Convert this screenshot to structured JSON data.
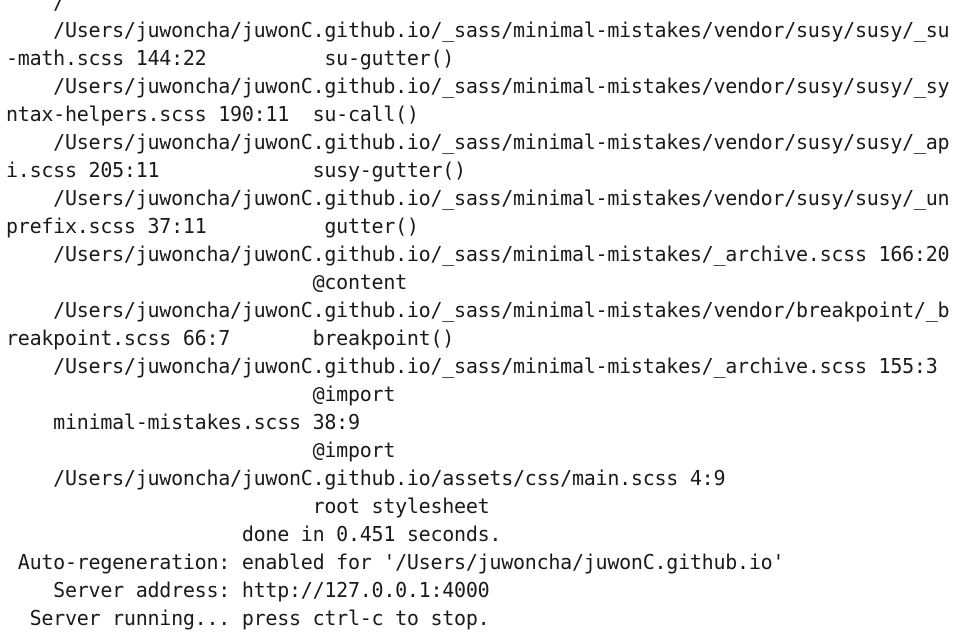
{
  "terminal": {
    "lines": [
      "    /",
      "    /Users/juwoncha/juwonC.github.io/_sass/minimal-mistakes/vendor/susy/susy/_su",
      "-math.scss 144:22          su-gutter()",
      "    /Users/juwoncha/juwonC.github.io/_sass/minimal-mistakes/vendor/susy/susy/_sy",
      "ntax-helpers.scss 190:11  su-call()",
      "    /Users/juwoncha/juwonC.github.io/_sass/minimal-mistakes/vendor/susy/susy/_ap",
      "i.scss 205:11             susy-gutter()",
      "    /Users/juwoncha/juwonC.github.io/_sass/minimal-mistakes/vendor/susy/susy/_un",
      "prefix.scss 37:11          gutter()",
      "    /Users/juwoncha/juwonC.github.io/_sass/minimal-mistakes/_archive.scss 166:20",
      "                          @content",
      "    /Users/juwoncha/juwonC.github.io/_sass/minimal-mistakes/vendor/breakpoint/_b",
      "reakpoint.scss 66:7       breakpoint()",
      "    /Users/juwoncha/juwonC.github.io/_sass/minimal-mistakes/_archive.scss 155:3",
      "                          @import",
      "    minimal-mistakes.scss 38:9",
      "                          @import",
      "    /Users/juwoncha/juwonC.github.io/assets/css/main.scss 4:9",
      "                          root stylesheet",
      "                    done in 0.451 seconds.",
      " Auto-regeneration: enabled for '/Users/juwoncha/juwonC.github.io'",
      "    Server address: http://127.0.0.1:4000",
      "  Server running... press ctrl-c to stop."
    ]
  }
}
